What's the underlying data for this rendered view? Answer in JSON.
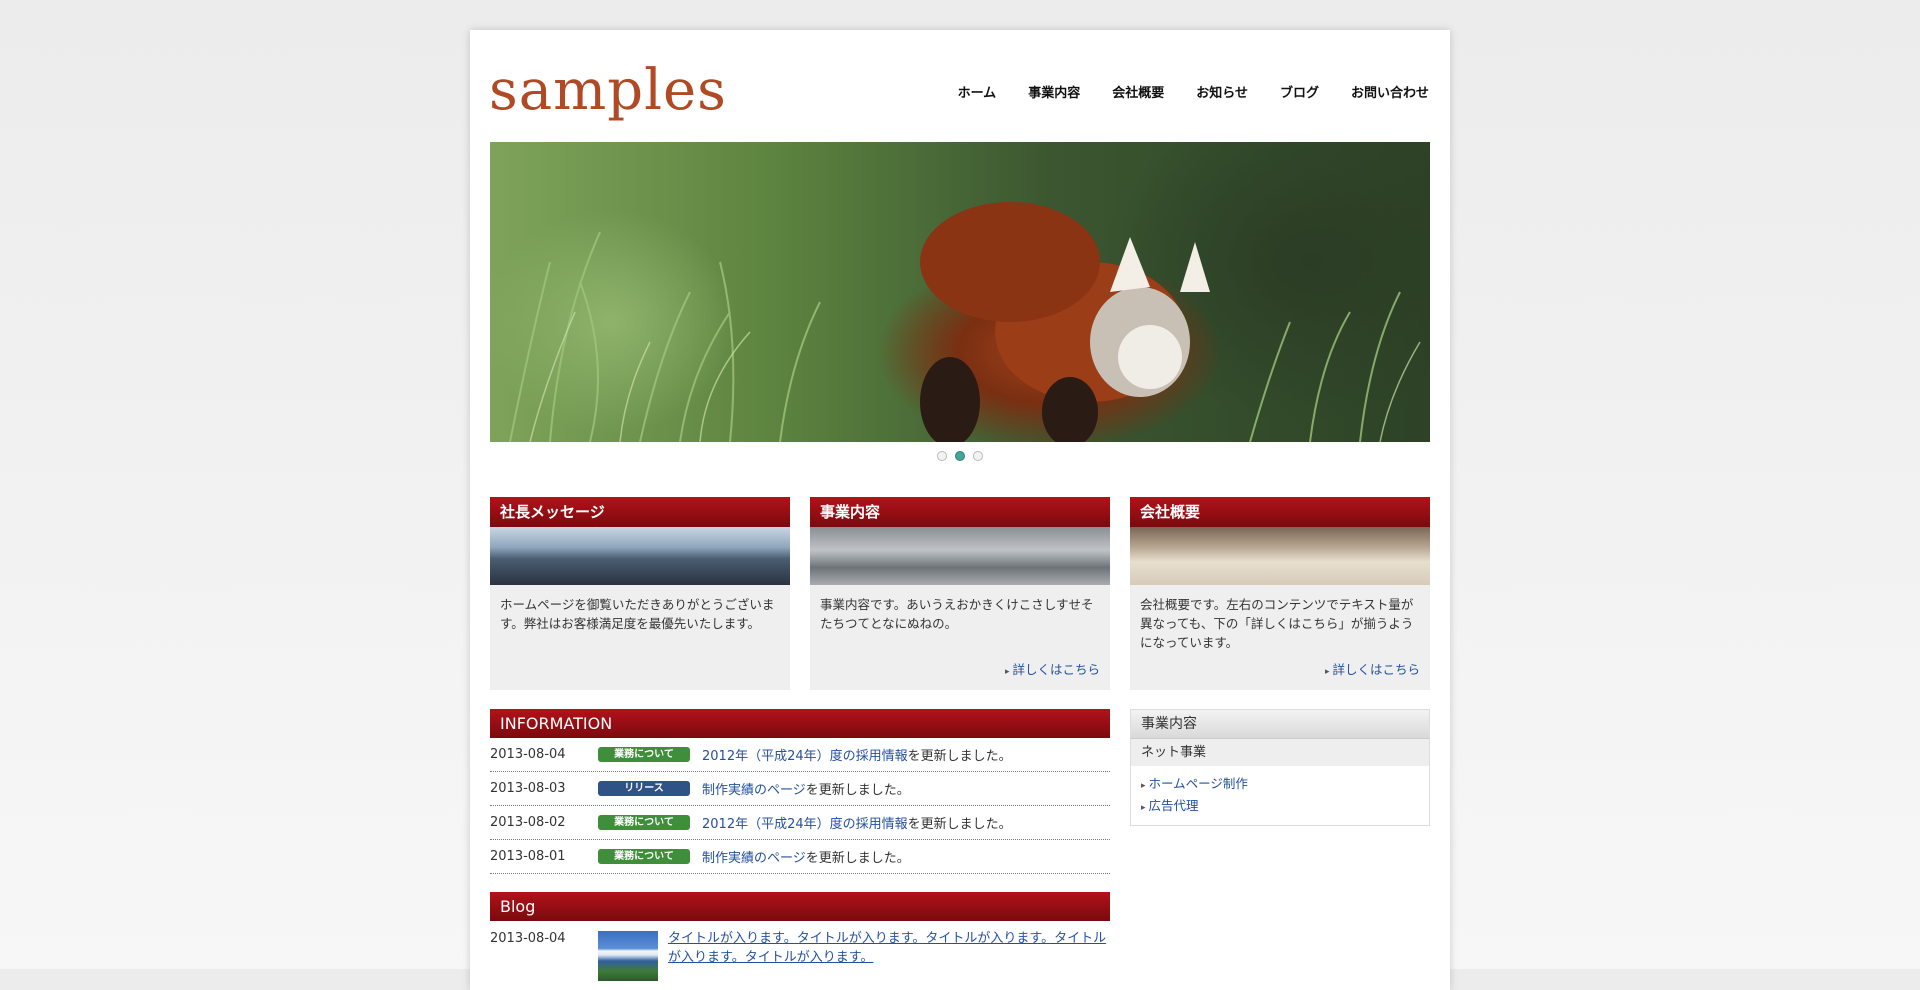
{
  "header": {
    "logo": "samples",
    "nav": [
      "ホーム",
      "事業内容",
      "会社概要",
      "お知らせ",
      "ブログ",
      "お問い合わせ"
    ]
  },
  "slider": {
    "total": 3,
    "active_index": 1
  },
  "boxes": [
    {
      "title": "社長メッセージ",
      "text": "ホームページを御覧いただきありがとうございます。弊社はお客様満足度を最優先いたします。",
      "link": ""
    },
    {
      "title": "事業内容",
      "text": "事業内容です。あいうえおかきくけこさしすせそたちつてとなにぬねの。",
      "link": "詳しくはこちら"
    },
    {
      "title": "会社概要",
      "text": "会社概要です。左右のコンテンツでテキスト量が異なっても、下の「詳しくはこちら」が揃うようになっています。",
      "link": "詳しくはこちら"
    }
  ],
  "information": {
    "title": "INFORMATION",
    "rows": [
      {
        "date": "2013-08-04",
        "badge": "業務について",
        "badge_color": "green",
        "link": "2012年（平成24年）度の採用情報",
        "suffix": "を更新しました。"
      },
      {
        "date": "2013-08-03",
        "badge": "リリース",
        "badge_color": "blue",
        "link": "制作実績のページ",
        "suffix": "を更新しました。"
      },
      {
        "date": "2013-08-02",
        "badge": "業務について",
        "badge_color": "green",
        "link": "2012年（平成24年）度の採用情報",
        "suffix": "を更新しました。"
      },
      {
        "date": "2013-08-01",
        "badge": "業務について",
        "badge_color": "green",
        "link": "制作実績のページ",
        "suffix": "を更新しました。"
      }
    ]
  },
  "sidebar": {
    "title": "事業内容",
    "subtitle": "ネット事業",
    "links": [
      "ホームページ制作",
      "広告代理"
    ]
  },
  "blog": {
    "title": "Blog",
    "posts": [
      {
        "date": "2013-08-04",
        "title": "タイトルが入ります。タイトルが入ります。タイトルが入ります。タイトルが入ります。タイトルが入ります。"
      }
    ]
  },
  "colors": {
    "accent_red": "#8e0c12",
    "logo": "#b04a25",
    "link": "#2450a0",
    "badge_green": "#3f8f3a",
    "badge_blue": "#2f5287"
  }
}
